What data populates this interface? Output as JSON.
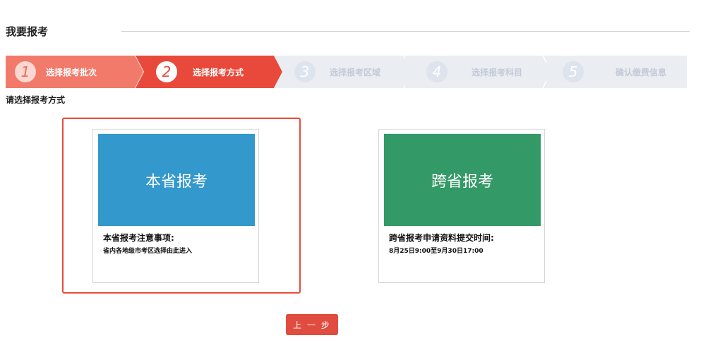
{
  "page": {
    "title": "我要报考",
    "subtitle": "请选择报考方式"
  },
  "steps": [
    {
      "num": "1",
      "label": "选择报考批次",
      "state": "done"
    },
    {
      "num": "2",
      "label": "选择报考方式",
      "state": "active"
    },
    {
      "num": "3",
      "label": "选择报考区域",
      "state": "todo"
    },
    {
      "num": "4",
      "label": "选择报考科目",
      "state": "todo"
    },
    {
      "num": "5",
      "label": "确认缴费信息",
      "state": "todo"
    }
  ],
  "options": {
    "local": {
      "banner": "本省报考",
      "note_title": "本省报考注意事项:",
      "note_body": "省内各地级市考区选择由此进入",
      "color": "#3398cc",
      "selected": true
    },
    "cross": {
      "banner": "跨省报考",
      "note_title": "跨省报考申请资料提交时间:",
      "note_body": "8月25日9:00至9月30日17:00",
      "color": "#339966",
      "selected": false
    }
  },
  "buttons": {
    "prev": "上 一 步"
  },
  "colors": {
    "step_done": "#f27a6b",
    "step_active": "#e8493a",
    "step_todo": "#eaedf1",
    "accent": "#e74c3c"
  }
}
